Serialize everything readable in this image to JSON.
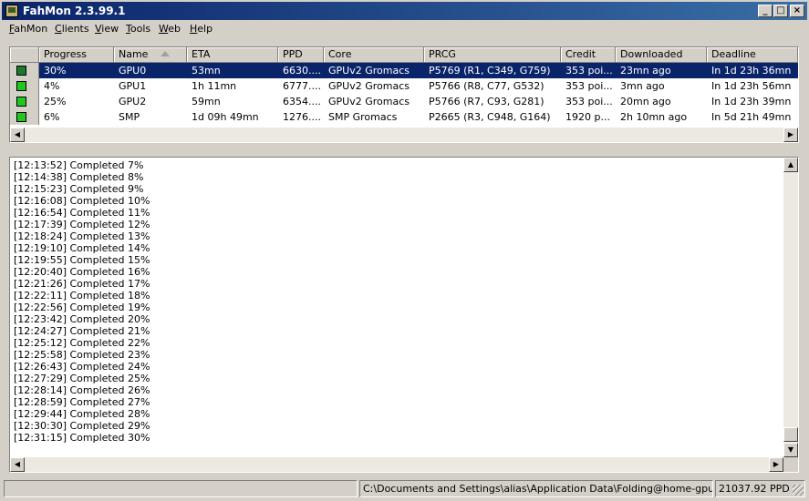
{
  "window": {
    "title": "FahMon 2.3.99.1",
    "controls": {
      "minimize": "_",
      "maximize": "□",
      "close": "×"
    }
  },
  "menu": [
    {
      "label": "FahMon",
      "accel": "F",
      "rest": "ahMon"
    },
    {
      "label": "Clients",
      "accel": "C",
      "rest": "lients"
    },
    {
      "label": "View",
      "accel": "V",
      "rest": "iew"
    },
    {
      "label": "Tools",
      "accel": "T",
      "rest": "ools"
    },
    {
      "label": "Web",
      "accel": "W",
      "rest": "eb"
    },
    {
      "label": "Help",
      "accel": "H",
      "rest": "elp"
    }
  ],
  "grid": {
    "columns": [
      "Progress",
      "Name",
      "ETA",
      "PPD",
      "Core",
      "PRCG",
      "Credit",
      "Downloaded",
      "Deadline"
    ],
    "sorted_column": "Name",
    "rows": [
      {
        "status_color": "#1a7a2a",
        "selected": true,
        "progress": "30%",
        "name": "GPU0",
        "eta": "53mn",
        "ppd": "6630....",
        "core": "GPUv2 Gromacs",
        "prcg": "P5769 (R1, C349, G759)",
        "credit": "353 poi...",
        "downloaded": "23mn ago",
        "deadline": "In 1d 23h 36mn"
      },
      {
        "status_color": "#1ec81e",
        "selected": false,
        "progress": "4%",
        "name": "GPU1",
        "eta": "1h 11mn",
        "ppd": "6777....",
        "core": "GPUv2 Gromacs",
        "prcg": "P5766 (R8, C77, G532)",
        "credit": "353 poi...",
        "downloaded": "3mn ago",
        "deadline": "In 1d 23h 56mn"
      },
      {
        "status_color": "#1ec81e",
        "selected": false,
        "progress": "25%",
        "name": "GPU2",
        "eta": "59mn",
        "ppd": "6354....",
        "core": "GPUv2 Gromacs",
        "prcg": "P5766 (R7, C93, G281)",
        "credit": "353 poi...",
        "downloaded": "20mn ago",
        "deadline": "In 1d 23h 39mn"
      },
      {
        "status_color": "#1ec81e",
        "selected": false,
        "progress": "6%",
        "name": "SMP",
        "eta": "1d 09h 49mn",
        "ppd": "1276....",
        "core": "SMP Gromacs",
        "prcg": "P2665 (R3, C948, G164)",
        "credit": "1920 p...",
        "downloaded": "2h 10mn ago",
        "deadline": "In 5d 21h 49mn"
      }
    ]
  },
  "log": [
    "[12:13:52] Completed 7%",
    "[12:14:38] Completed 8%",
    "[12:15:23] Completed 9%",
    "[12:16:08] Completed 10%",
    "[12:16:54] Completed 11%",
    "[12:17:39] Completed 12%",
    "[12:18:24] Completed 13%",
    "[12:19:10] Completed 14%",
    "[12:19:55] Completed 15%",
    "[12:20:40] Completed 16%",
    "[12:21:26] Completed 17%",
    "[12:22:11] Completed 18%",
    "[12:22:56] Completed 19%",
    "[12:23:42] Completed 20%",
    "[12:24:27] Completed 21%",
    "[12:25:12] Completed 22%",
    "[12:25:58] Completed 23%",
    "[12:26:43] Completed 24%",
    "[12:27:29] Completed 25%",
    "[12:28:14] Completed 26%",
    "[12:28:59] Completed 27%",
    "[12:29:44] Completed 28%",
    "[12:30:30] Completed 29%",
    "[12:31:15] Completed 30%"
  ],
  "scroll_glyphs": {
    "up": "▲",
    "down": "▼",
    "left": "◀",
    "right": "▶"
  },
  "statusbar": {
    "path": "C:\\Documents and Settings\\alias\\Application Data\\Folding@home-gpu\\",
    "total_ppd": "21037.92 PPD"
  }
}
